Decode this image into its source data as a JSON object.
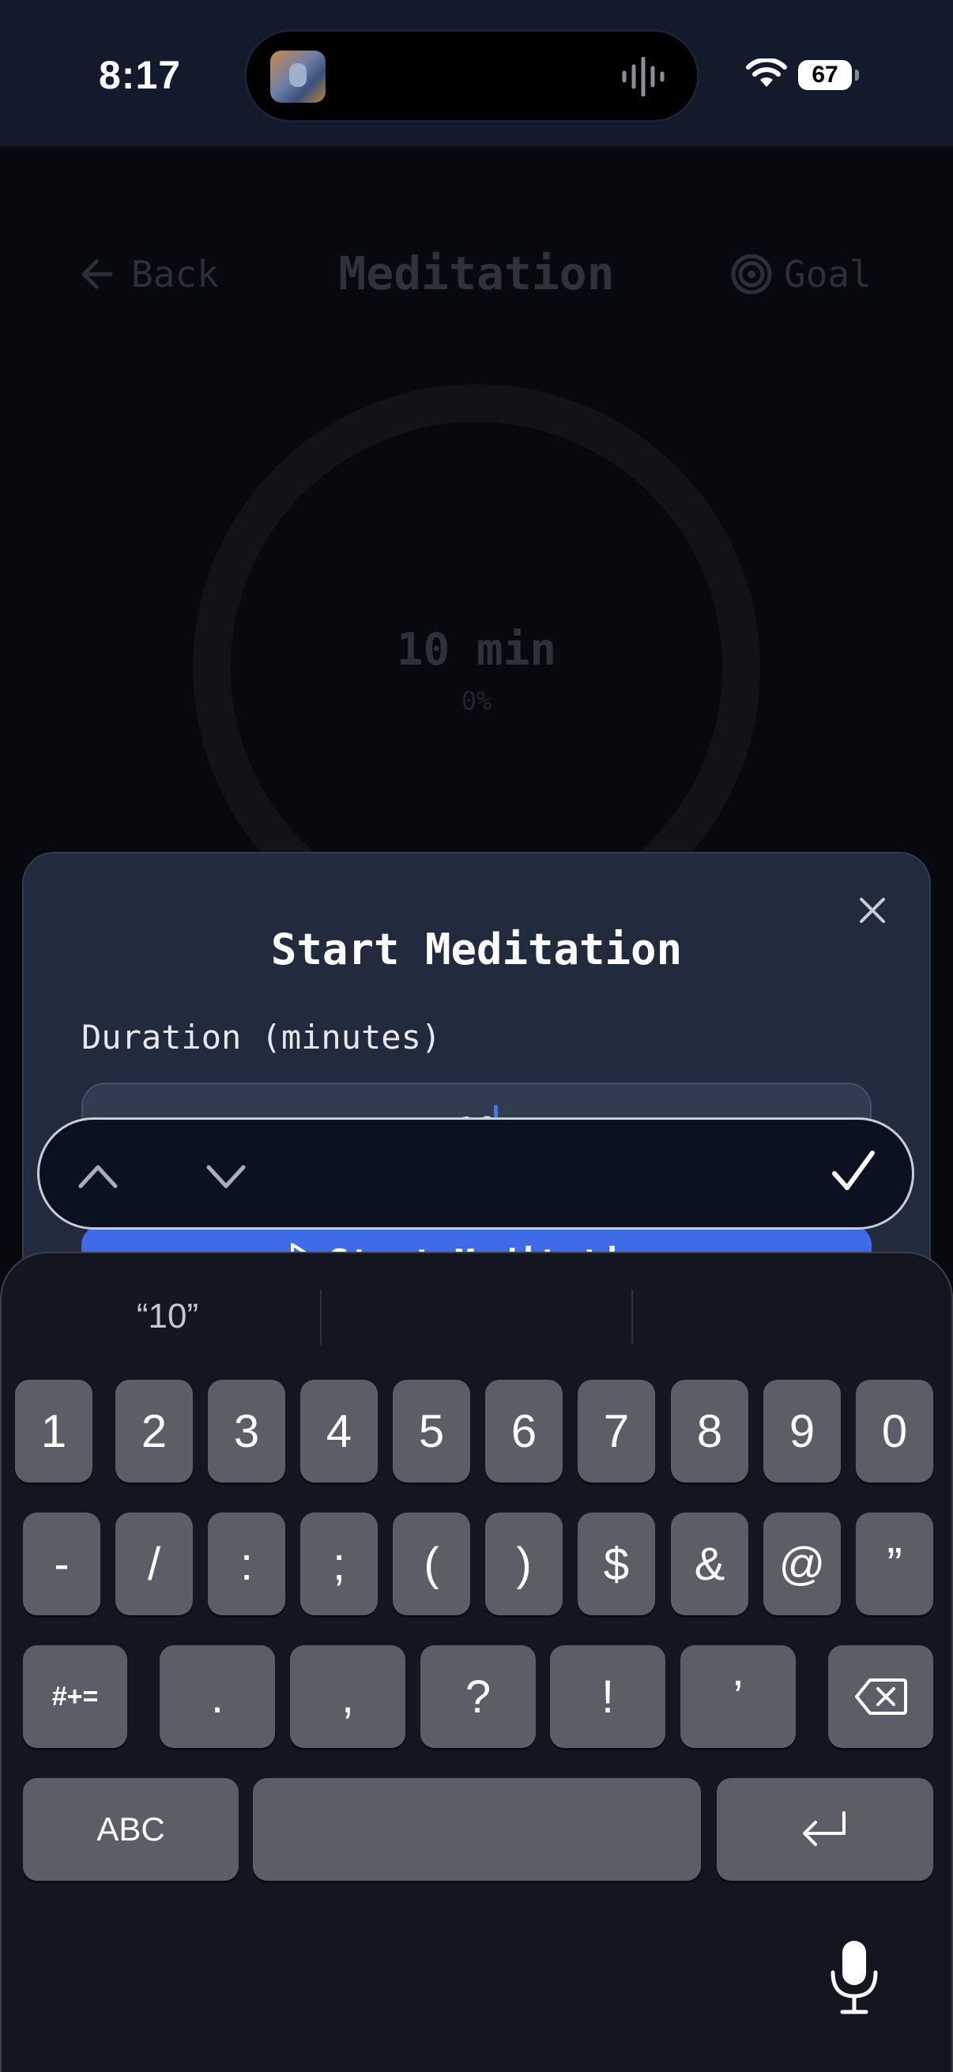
{
  "status_bar": {
    "time": "8:17",
    "battery": "67"
  },
  "header": {
    "back_label": "Back",
    "title": "Meditation",
    "goal_label": "Goal"
  },
  "progress": {
    "value_label": "10 min",
    "percent_label": "0%",
    "percent": 0
  },
  "modal": {
    "title": "Start Meditation",
    "duration_label": "Duration (minutes)",
    "duration_value": "10",
    "start_button_label": "Start Meditation"
  },
  "keyboard": {
    "suggestions": [
      "“10”",
      "",
      ""
    ],
    "row1": [
      "1",
      "2",
      "3",
      "4",
      "5",
      "6",
      "7",
      "8",
      "9",
      "0"
    ],
    "row2": [
      "-",
      "/",
      ":",
      ";",
      "(",
      ")",
      "$",
      "&",
      "@",
      "”"
    ],
    "row3_symbols_toggle": "#+=",
    "row3": [
      ".",
      ",",
      "?",
      "!",
      "’"
    ],
    "abc_label": "ABC"
  },
  "icons": {
    "back": "arrow-left-icon",
    "goal": "target-icon",
    "close": "close-icon",
    "up": "chevron-up-icon",
    "down": "chevron-down-icon",
    "done": "checkmark-icon",
    "backspace": "backspace-icon",
    "return": "return-icon",
    "mic": "microphone-icon"
  },
  "colors": {
    "accent": "#3f6be8",
    "modal": "#222a3d",
    "keyboard": "#131620",
    "key": "#5b5e66"
  }
}
